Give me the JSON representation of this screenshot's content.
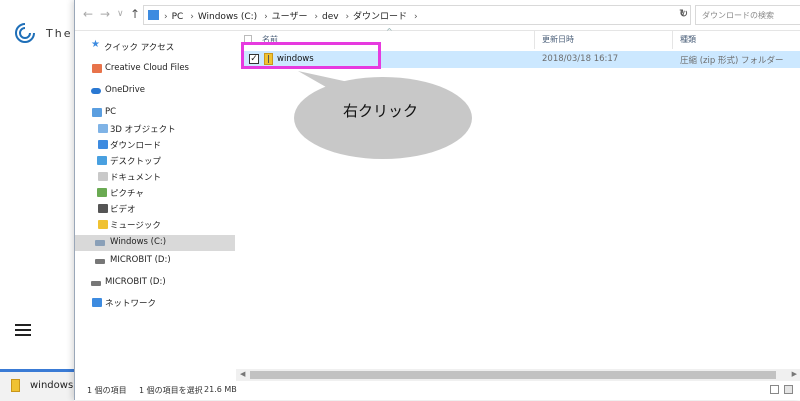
{
  "background_page": {
    "logo_text": "The",
    "download_file": "windows.zip"
  },
  "explorer": {
    "address": {
      "crumbs": [
        "PC",
        "Windows (C:)",
        "ユーザー",
        "dev",
        "ダウンロード"
      ],
      "search_placeholder": "ダウンロードの検索"
    },
    "nav": {
      "quick_access": "クイック アクセス",
      "creative_cloud": "Creative Cloud Files",
      "onedrive": "OneDrive",
      "pc": "PC",
      "objects3d": "3D オブジェクト",
      "downloads": "ダウンロード",
      "desktop": "デスクトップ",
      "documents": "ドキュメント",
      "pictures": "ピクチャ",
      "videos": "ビデオ",
      "music": "ミュージック",
      "windows_c": "Windows (C:)",
      "microbit_d1": "MICROBIT (D:)",
      "microbit_d2": "MICROBIT (D:)",
      "network": "ネットワーク"
    },
    "columns": {
      "name": "名前",
      "date": "更新日時",
      "type": "種類"
    },
    "file": {
      "name": "windows",
      "date": "2018/03/18 16:17",
      "type": "圧縮 (zip 形式) フォルダー"
    },
    "annotation": "右クリック",
    "status": {
      "count": "1 個の項目",
      "selected": "1 個の項目を選択",
      "size": "21.6 MB"
    }
  },
  "colors": {
    "selection": "#cce8ff",
    "highlight_border": "#e63adf",
    "bubble_fill": "#c8c8c8"
  }
}
